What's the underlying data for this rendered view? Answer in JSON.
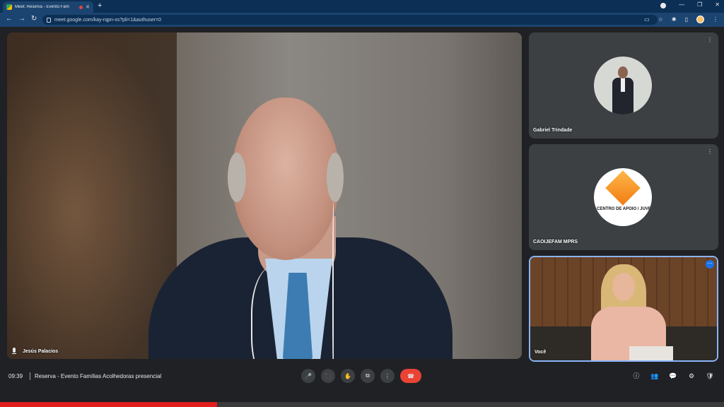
{
  "browser": {
    "tab_title": "Meet: Reserva - Evento Fam",
    "tab_close": "✕",
    "new_tab": "+",
    "url": "meet.google.com/kay-rqpn-xs?pli=1&authuser=0",
    "window_controls": [
      "—",
      "❐",
      "✕"
    ]
  },
  "participants": [
    {
      "name": "Jesús Palacios",
      "kind": "main-video"
    },
    {
      "name": "Gabriel Trindade",
      "kind": "avatar"
    },
    {
      "name": "CAOIJEFAM MPRS",
      "kind": "logo",
      "logo_text": "CENTRO DE APOIO / JUVENTUDE, EDU"
    },
    {
      "name": "Você",
      "kind": "self-video"
    }
  ],
  "meeting": {
    "time": "09:39",
    "title": "Reserva - Evento Famílias Acolhedoras presencial"
  },
  "controls": {
    "mic": "🎤",
    "camera": "⬛",
    "raise_hand": "✋",
    "present": "⧉",
    "more": "⋮",
    "end_call": "☎"
  },
  "right_controls": {
    "info": "ⓘ",
    "people": "👥",
    "chat": "💬",
    "activities": "⚙",
    "host": "🛡"
  },
  "video_progress": 0.3,
  "colors": {
    "end_call": "#ea4335",
    "accent": "#8ab4f8",
    "progress": "#e11d1d"
  }
}
